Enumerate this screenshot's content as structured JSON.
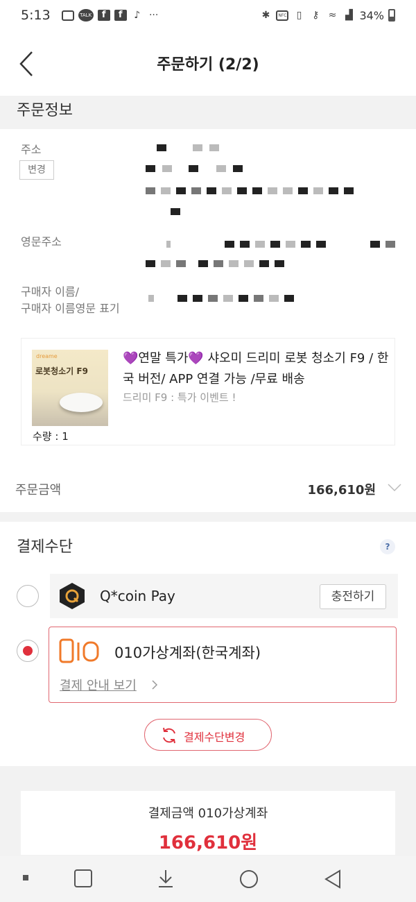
{
  "status_bar": {
    "time": "5:13",
    "battery": "34%",
    "talk_label": "TALK",
    "fb_label": "f",
    "more": "···",
    "nfc": "NFC"
  },
  "header": {
    "title": "주문하기 (2/2)",
    "back_icon": "chevron-left-icon"
  },
  "order_info": {
    "section_title": "주문정보",
    "address_label": "주소",
    "change_button": "변경",
    "english_address_label": "영문주소",
    "buyer_name_label_1": "구매자 이름/",
    "buyer_name_label_2": "구매자 이름영문 표기"
  },
  "product": {
    "title_heart_left": "💜",
    "title_text": "연말 특가",
    "title_heart_right": "💜",
    "title_rest": " 샤오미 드리미 로봇 청소기 F9 / 한국 버전/ APP 연결 가능 /무료 배송",
    "subtitle": "드리미 F9 : 특가 이벤트 !",
    "quantity": "수량 : 1",
    "thumb_brand": "dreame",
    "thumb_title": "로봇청소기 F9"
  },
  "order_amount": {
    "label": "주문금액",
    "value": "166,610원"
  },
  "payment": {
    "section_title": "결제수단",
    "help_icon": "?",
    "options": [
      {
        "name": "Q*coin Pay",
        "action": "충전하기",
        "selected": false
      },
      {
        "name": "010가상계좌(한국계좌)",
        "guide": "결제 안내 보기",
        "selected": true
      }
    ],
    "change_button": "결제수단변경"
  },
  "summary": {
    "label": "결제금액 010가상계좌",
    "value": "166,610원"
  },
  "colors": {
    "accent": "#e0303c",
    "section_bg": "#f2f2f2",
    "border_selected": "#e06670"
  }
}
